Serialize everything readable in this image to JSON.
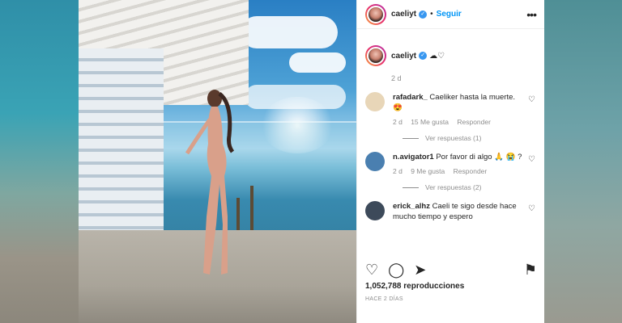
{
  "post": {
    "username": "caeliyt",
    "verified_mark": "✓",
    "separator": "•",
    "follow_label": "Seguir",
    "more_label": "•••",
    "caption_icons": "☁♡",
    "caption_time": "2 d",
    "views": "1,052,788 reproducciones",
    "posted_ago": "HACE 2 DÍAS"
  },
  "comments": [
    {
      "user": "rafadark_",
      "text": "Caeliker hasta la muerte. 😍",
      "time": "2 d",
      "likes": "15 Me gusta",
      "reply": "Responder",
      "view_replies": "Ver respuestas (1)",
      "avatar_color": "#e8d6b8"
    },
    {
      "user": "n.avigator1",
      "text": "Por favor di algo 🙏 😭 ?",
      "time": "2 d",
      "likes": "9 Me gusta",
      "reply": "Responder",
      "view_replies": "Ver respuestas (2)",
      "avatar_color": "#4a7fb0"
    },
    {
      "user": "erick_alhz",
      "text": "Caeli te sigo desde hace mucho tiempo y espero",
      "avatar_color": "#3d4a5a"
    }
  ],
  "icons": {
    "heart": "♡",
    "comment": "◯",
    "share": "➤",
    "bookmark": "⚑"
  },
  "colors": {
    "accent": "#0095f6",
    "verified": "#3897f0",
    "text": "#262626",
    "muted": "#8e8e8e"
  }
}
